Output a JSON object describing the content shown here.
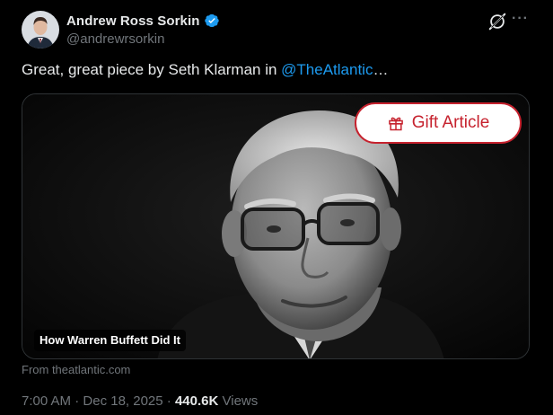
{
  "author": {
    "display_name": "Andrew Ross Sorkin",
    "handle": "@andrewrsorkin",
    "verified": true,
    "avatar_icon": "profile-photo"
  },
  "tweet": {
    "text_prefix": "Great, great piece by Seth Klarman in ",
    "mention": "@TheAtlantic",
    "text_suffix": "…"
  },
  "actions": {
    "grok_icon": "grok-icon",
    "more_icon": "more-icon",
    "more_label": "···"
  },
  "card": {
    "title": "How Warren Buffett Did It",
    "gift_button_label": "Gift Article",
    "gift_icon": "gift-icon",
    "source_text": "From theatlantic.com"
  },
  "meta": {
    "time": "7:00 AM",
    "separator1": " · ",
    "date": "Dec 18, 2025",
    "separator2": " · ",
    "views_count": "440.6K",
    "views_label": " Views"
  },
  "colors": {
    "background": "#000000",
    "text": "#e7e9ea",
    "muted": "#71767b",
    "link": "#1d9bf0",
    "gift_red": "#c6222e"
  }
}
